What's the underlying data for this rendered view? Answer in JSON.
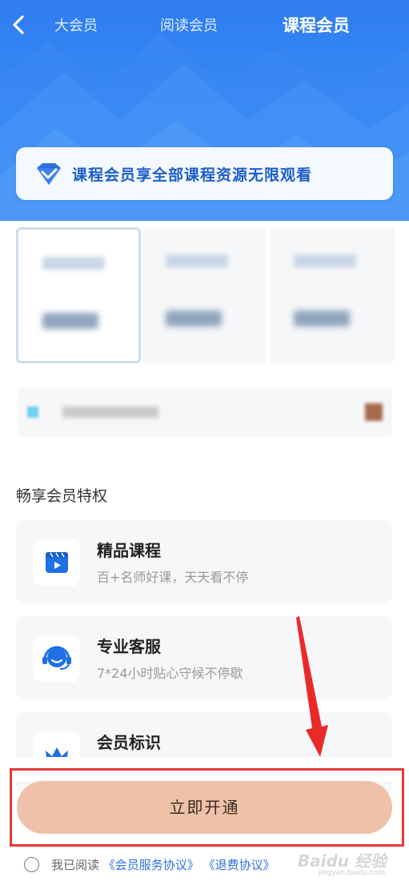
{
  "nav": {
    "back_icon": "chevron-left-icon",
    "tabs": [
      {
        "label": "大会员",
        "active": false
      },
      {
        "label": "阅读会员",
        "active": false
      },
      {
        "label": "课程会员",
        "active": true
      }
    ]
  },
  "banner": {
    "icon": "diamond-icon",
    "text": "课程会员享全部课程资源无限观看"
  },
  "section_title": "畅享会员特权",
  "privileges": [
    {
      "icon": "video-course-icon",
      "title": "精品课程",
      "desc": "百+名师好课，天天看不停"
    },
    {
      "icon": "customer-service-icon",
      "title": "专业客服",
      "desc": "7*24小时贴心守候不停歇"
    },
    {
      "icon": "crown-icon",
      "title": "会员标识",
      "desc": ""
    }
  ],
  "cta": {
    "label": "立即开通"
  },
  "agreement": {
    "prefix": "我已阅读",
    "link1": "《会员服务协议》",
    "link2": "《退费协议》"
  },
  "watermark": {
    "main": "Baidu 经验",
    "sub": "jingyan.baidu.com"
  },
  "colors": {
    "header": "#2f7df0",
    "accent_text": "#1d5dc8",
    "cta_bg": "#eec2a8",
    "highlight_box": "#e53935",
    "link": "#2f6fdc"
  }
}
